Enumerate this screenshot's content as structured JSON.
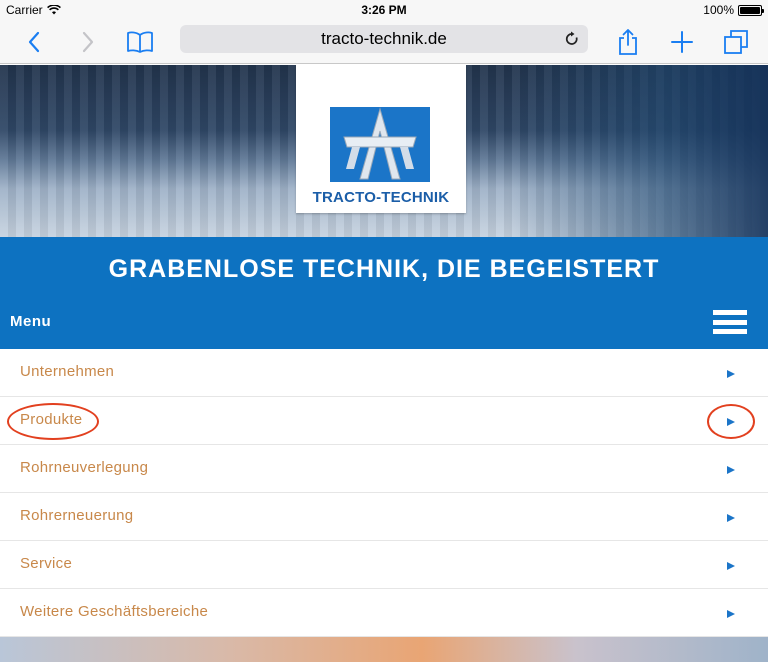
{
  "status_bar": {
    "carrier": "Carrier",
    "time": "3:26 PM",
    "battery": "100%"
  },
  "browser": {
    "url": "tracto-technik.de",
    "icons": [
      "back-icon",
      "forward-icon",
      "bookmarks-icon",
      "reload-icon",
      "share-icon",
      "add-icon",
      "tabs-icon"
    ],
    "accent": "#1a7ef2"
  },
  "hero": {
    "logo_text": "TRACTO-TECHNIK"
  },
  "headline": "GRABENLOSE TECHNIK, DIE BEGEISTERT",
  "menu": {
    "label": "Menu",
    "items": [
      {
        "label": "Unternehmen"
      },
      {
        "label": "Produkte"
      },
      {
        "label": "Rohrneuverlegung"
      },
      {
        "label": "Rohrerneuerung"
      },
      {
        "label": "Service"
      },
      {
        "label": "Weitere Geschäftsbereiche"
      }
    ]
  },
  "colors": {
    "brand_blue": "#0d72c1",
    "item_text": "#c8884a",
    "arrow": "#1b75c8",
    "annotation": "#e2401f"
  }
}
